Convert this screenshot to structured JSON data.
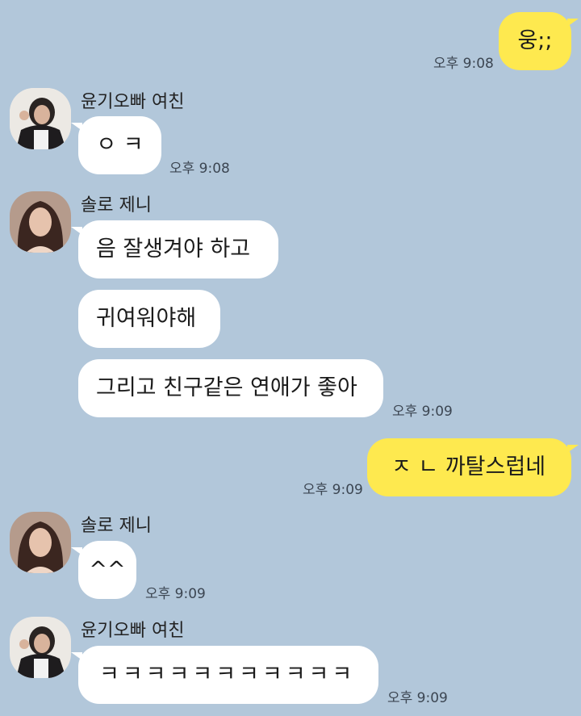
{
  "messages": [
    {
      "text": "웅;;",
      "time": "오후 9:08"
    },
    {
      "sender": "윤기오빠 여친",
      "text": "ㅇ ㅋ",
      "time": "오후 9:08"
    },
    {
      "sender": "솔로 제니",
      "texts": [
        "음 잘생겨야 하고",
        "귀여워야해",
        "그리고 친구같은 연애가 좋아"
      ],
      "time": "오후 9:09"
    },
    {
      "text": "ㅈ ㄴ 까탈스럽네",
      "time": "오후 9:09"
    },
    {
      "sender": "솔로 제니",
      "text": "^^",
      "time": "오후 9:09"
    },
    {
      "sender": "윤기오빠 여친",
      "text": "ㅋㅋㅋㅋㅋㅋㅋㅋㅋㅋㅋ",
      "time": "오후 9:09"
    }
  ],
  "colors": {
    "background": "#b2c7da",
    "my_bubble": "#fee94f",
    "their_bubble": "#ffffff"
  }
}
